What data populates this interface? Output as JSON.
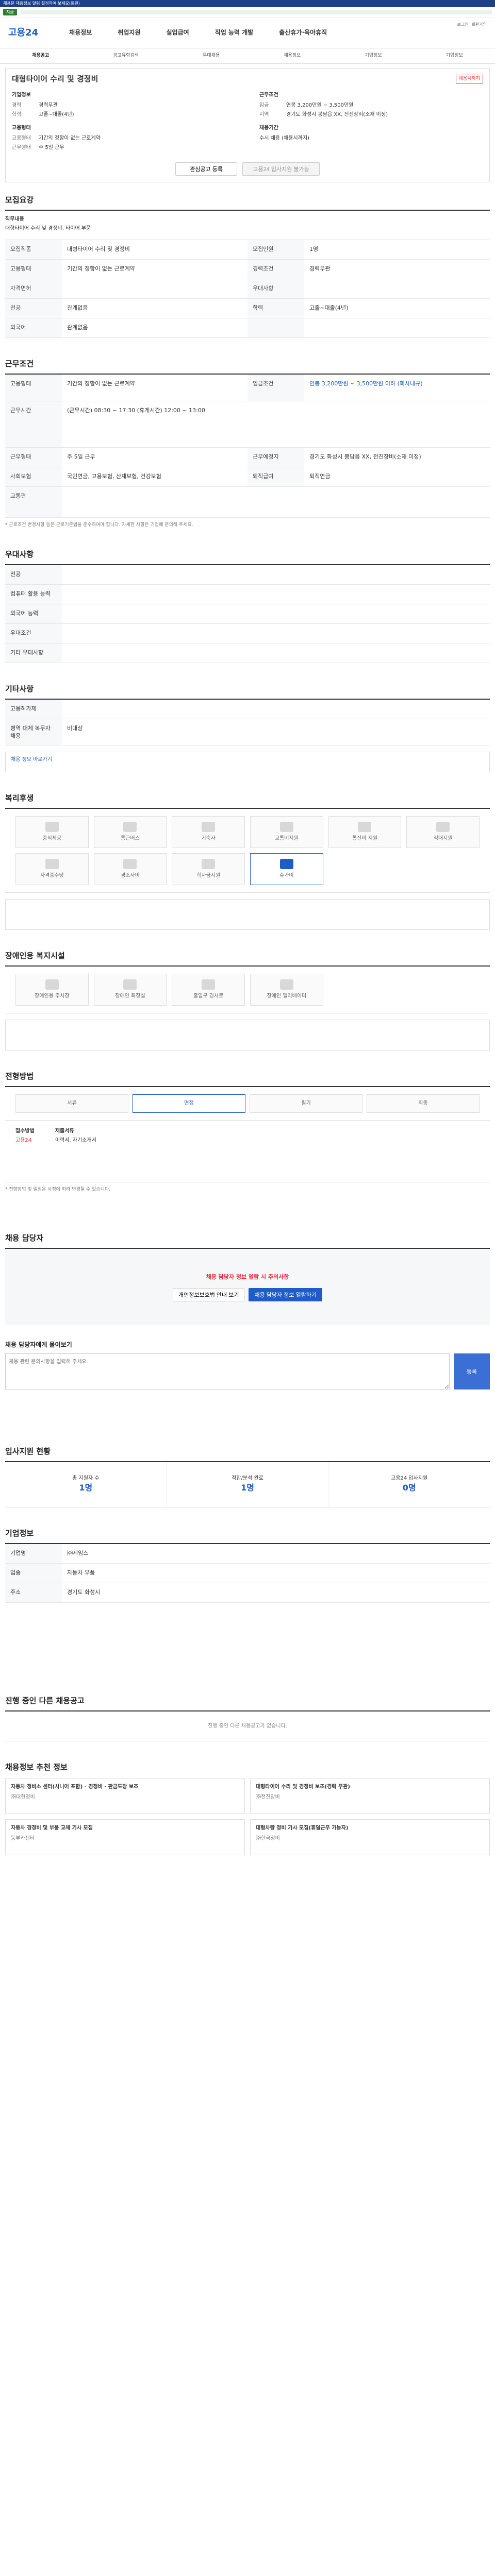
{
  "topbar": {
    "notice": "채용된 채용정보 알림 설정하여 보세요(회원)",
    "tag": "지금"
  },
  "header": {
    "logo": "고용24",
    "nav": [
      "채용정보",
      "취업지원",
      "실업급여",
      "직업 능력 개발",
      "출산휴가·육아휴직"
    ],
    "small_links": [
      "로그인",
      "회원가입"
    ]
  },
  "subnav": [
    "채용공고",
    "공고유형검색",
    "우대채용",
    "채용정보",
    "기업정보",
    "기업정보"
  ],
  "job": {
    "title": "대형타이어 수리 및 경정비",
    "badge": "채용시까지",
    "company_label": "기업정보",
    "company": "㈜제임스",
    "industry_label": "업종",
    "industry": "자동차 부품",
    "scale_label": "규모",
    "scale": "5인 이상",
    "career_label": "경력",
    "career": "경력무관",
    "edu_label": "학력",
    "edu": "고졸~대졸(4년)",
    "emp_label": "고용형태",
    "emp": "기간의 정함이 없는 근로계약",
    "work_label": "근무형태",
    "work": "주 5일 근무",
    "cond_label": "근무조건",
    "wage_label": "임금",
    "wage": "연봉 3,200만원 ~ 3,500만원",
    "place_label": "지역",
    "place": "경기도 화성시 봉담읍 XX, 전진장비(소재 미정)",
    "deadline_label": "채용기간",
    "deadline": "수시 채용 (채용시까지)",
    "btn_interest": "관심공고 등록",
    "btn_apply": "고용24 입사지원 불가능"
  },
  "sec_recruit": {
    "title": "모집요강",
    "desc_label": "직무내용",
    "desc": "대형타이어 수리 및 경정비, 타이어 부품",
    "rows": [
      [
        "모집직종",
        "대형타이어 수리 및 경정비",
        "모집인원",
        "1명"
      ],
      [
        "고용형태",
        "기간의 정함이 없는 근로계약",
        "경력조건",
        "경력무관"
      ],
      [
        "자격면허",
        "",
        "우대사항",
        ""
      ],
      [
        "전공",
        "관계없음",
        "학력",
        "고졸~대졸(4년)"
      ],
      [
        "외국어",
        "관계없음",
        "",
        ""
      ]
    ]
  },
  "sec_cond": {
    "title": "근무조건",
    "rows": [
      [
        "고용형태",
        "기간의 정함이 없는 근로계약",
        "임금조건",
        "연봉 3,200만원 ~ 3,500만원 이하 (회사내규)"
      ],
      [
        "근무시간",
        "(근무시간) 08:30 ~ 17:30 (휴게시간) 12:00 ~ 13:00",
        "",
        ""
      ],
      [
        "근무형태",
        "주 5일 근무",
        "근무예정지",
        "경기도 화성시 봉담읍 XX, 전진장비(소재 미정)"
      ],
      [
        "사회보험",
        "국민연금, 고용보험, 산재보험, 건강보험",
        "퇴직급여",
        "퇴직연금"
      ],
      [
        "교통편",
        "",
        "",
        ""
      ]
    ],
    "note": "* 근로조건 변경사항 등은 근로기준법을 준수하여야 합니다. 자세한 사항은 기업에 문의해 주세요."
  },
  "sec_pref": {
    "title": "우대사항",
    "rows": [
      [
        "전공",
        ""
      ],
      [
        "컴퓨터 활용 능력",
        ""
      ],
      [
        "외국어 능력",
        ""
      ],
      [
        "우대조건",
        ""
      ],
      [
        "기타 우대사항",
        ""
      ]
    ]
  },
  "sec_etc": {
    "title": "기타사항",
    "rows": [
      [
        "고용허가제",
        ""
      ],
      [
        "병역 대체 복무자 채용",
        "비대상"
      ]
    ],
    "link": "채용 정보 바로가기"
  },
  "sec_welfare": {
    "title": "복리후생",
    "items": [
      "중식제공",
      "통근버스",
      "기숙사",
      "교통비지원",
      "통신비 지원",
      "식대지원",
      "자격증수당",
      "경조사비",
      "학자금지원",
      "휴가비"
    ]
  },
  "sec_disable": {
    "title": "장애인용 복지시설",
    "items": [
      "장애인용 주차장",
      "장애인 화장실",
      "출입구 경사로",
      "장애인 엘리베이터"
    ]
  },
  "sec_process": {
    "title": "전형방법",
    "steps": [
      "서류",
      "면접",
      "필기",
      "최종"
    ],
    "method_label": "접수방법",
    "method": "고용24",
    "docs_label": "제출서류",
    "docs": "이력서, 자기소개서",
    "note": "* 전형방법 및 일정은 사정에 따라 변경될 수 있습니다."
  },
  "sec_contact": {
    "title": "채용 담당자",
    "alert": "채용 담당자 정보 열람 시 주의사항",
    "btn1": "개인정보보호법 안내 보기",
    "btn2": "채용 담당자 정보 열람하기"
  },
  "sec_qna": {
    "title": "채용 담당자에게 물어보기",
    "placeholder": "채용 관련 문의사항을 입력해 주세요.",
    "btn": "등록"
  },
  "sec_stats": {
    "title": "입사지원 현황",
    "stats": [
      [
        "총 지원자 수",
        "1명"
      ],
      [
        "적합/분석 완료",
        "1명"
      ],
      [
        "고용24 입사지원",
        "0명"
      ]
    ]
  },
  "sec_company": {
    "title": "기업정보",
    "rows": [
      [
        "기업명",
        "㈜제임스"
      ],
      [
        "업종",
        "자동차 부품"
      ],
      [
        "주소",
        "경기도 화성시"
      ]
    ]
  },
  "sec_others": {
    "title": "진행 중인 다른 채용공고",
    "empty": "진행 중인 다른 채용공고가 없습니다."
  },
  "sec_similar": {
    "title": "채용정보 추천 정보",
    "items": [
      [
        "자동차 정비소 센터(시니어 포함) - 경정비 · 판금도장 보조",
        "㈜대현정비"
      ],
      [
        "대형타이어 수리 및 경정비 보조(경력 무관)",
        "㈜전진장비"
      ],
      [
        "자동차 경정비 및 부품 교체 기사 모집",
        "동부카센터"
      ],
      [
        "대형차량 정비 기사 모집(휴일근무 가능자)",
        "㈜한국정비"
      ]
    ]
  }
}
